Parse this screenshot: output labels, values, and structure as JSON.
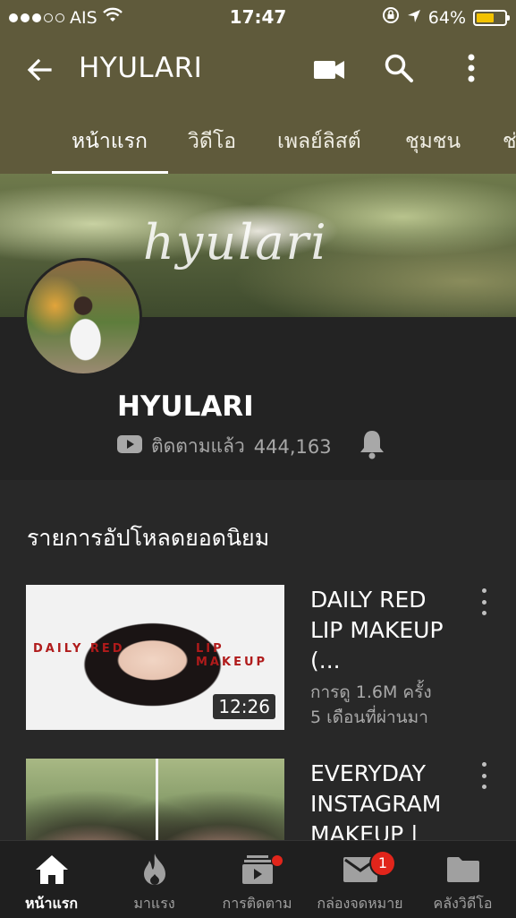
{
  "status_bar": {
    "carrier": "AIS",
    "time": "17:47",
    "battery": "64%",
    "battery_level": 0.64,
    "icons": [
      "signal-dots",
      "wifi-icon",
      "orientation-lock-icon",
      "location-arrow-icon",
      "battery-icon"
    ]
  },
  "app_bar": {
    "title": "HYULARI",
    "icons": [
      "back-arrow-icon",
      "video-camera-icon",
      "search-icon",
      "more-vert-icon"
    ]
  },
  "tabs": [
    {
      "label": "หน้าแรก",
      "active": true
    },
    {
      "label": "วิดีโอ",
      "active": false
    },
    {
      "label": "เพลย์ลิสต์",
      "active": false
    },
    {
      "label": "ชุมชน",
      "active": false
    },
    {
      "label": "ช่",
      "active": false
    }
  ],
  "banner": {
    "signature": "hyulari"
  },
  "channel": {
    "name": "HYULARI",
    "subscribed_label": "ติดตามแล้ว",
    "subscribers": "444,163"
  },
  "section": {
    "title": "รายการอัปโหลดยอดนิยม"
  },
  "videos": [
    {
      "title": "DAILY RED LIP MAKEUP (...",
      "thumb_text_left": "DAILY RED",
      "thumb_text_right": "LIP MAKEUP",
      "duration": "12:26",
      "views": "การดู 1.6M ครั้ง",
      "age": "5 เดือนที่ผ่านมา"
    },
    {
      "title": "EVERYDAY INSTAGRAM MAKEUP |"
    }
  ],
  "bottom_nav": [
    {
      "label": "หน้าแรก",
      "icon": "home-icon",
      "active": true
    },
    {
      "label": "มาแรง",
      "icon": "flame-icon",
      "active": false
    },
    {
      "label": "การติดตาม",
      "icon": "subscriptions-icon",
      "active": false
    },
    {
      "label": "กล่องจดหมาย",
      "icon": "mail-icon",
      "active": false,
      "badge": "1"
    },
    {
      "label": "คลังวิดีโอ",
      "icon": "folder-icon",
      "active": false
    }
  ],
  "colors": {
    "app_bar": "#5f5a3b",
    "background": "#282828",
    "badge": "#e1251b",
    "battery_fill": "#f2c200"
  }
}
